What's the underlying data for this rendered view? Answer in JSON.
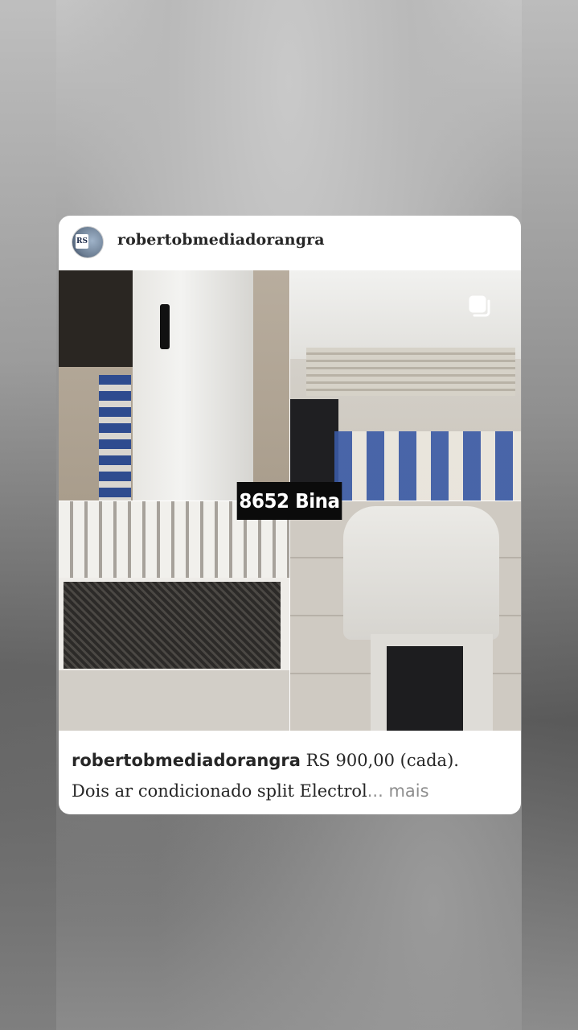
{
  "post": {
    "username": "robertobmediadorangra",
    "avatar_initials": "RS",
    "watermark": "8652 Bina",
    "caption": {
      "username": "robertobmediadorangra",
      "line1_text": " RS 900,00 (cada).",
      "line2_text": "Dois ar condicionado split Electrol",
      "ellipsis": "... ",
      "more_label": "mais"
    }
  },
  "icons": {
    "multi_photo": "carousel-icon"
  },
  "colors": {
    "card_bg": "#ffffff",
    "text": "#262626",
    "more_text": "#8e8e8e",
    "watermark_bg": "#0b0b0b"
  }
}
